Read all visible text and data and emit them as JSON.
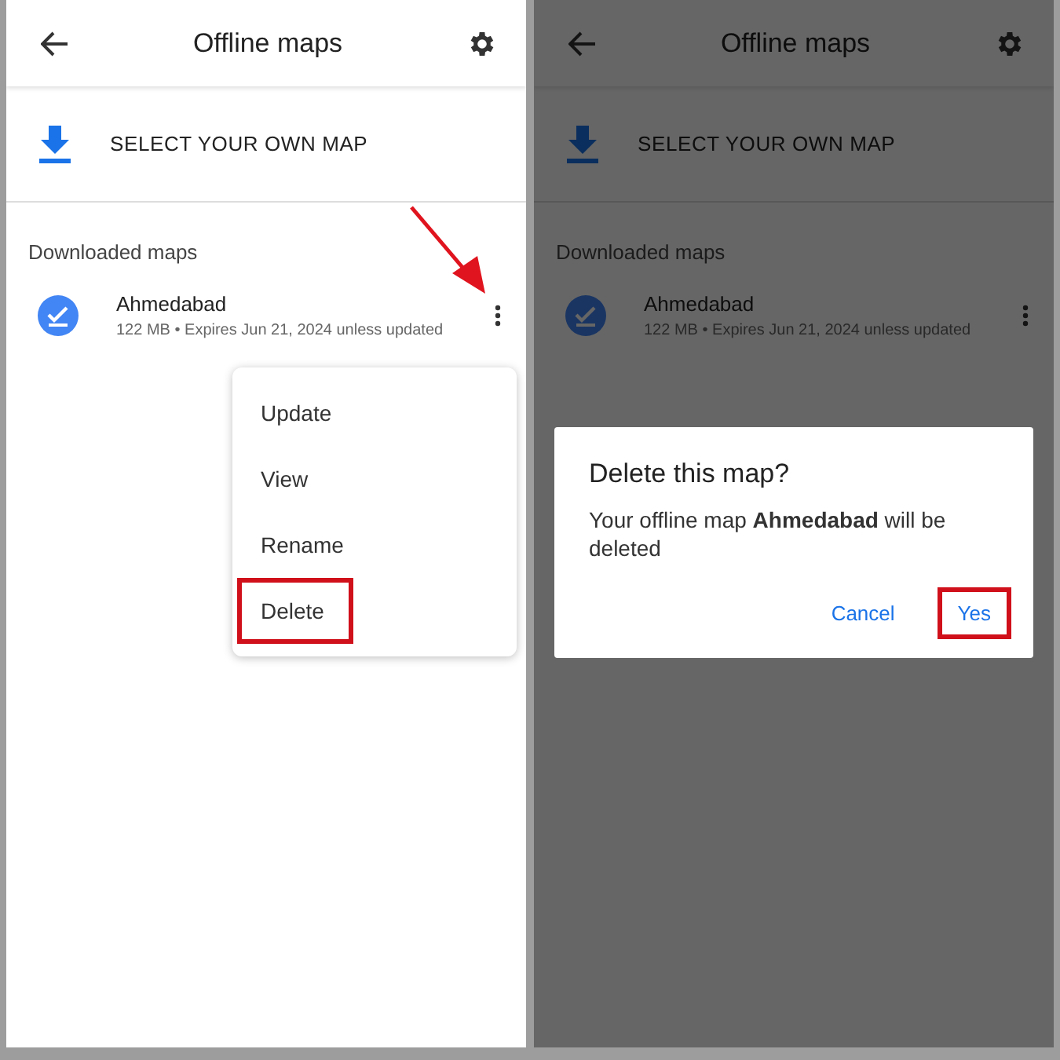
{
  "panels": [
    {
      "dimmed": false,
      "annotation_arrow": true,
      "header": {
        "title": "Offline maps"
      },
      "select_own_map": "SELECT YOUR OWN MAP",
      "section_title": "Downloaded maps",
      "maps": [
        {
          "name": "Ahmedabad",
          "details": "122 MB • Expires Jun 21, 2024 unless updated"
        }
      ],
      "menu": {
        "items": [
          {
            "label": "Update",
            "highlighted": false
          },
          {
            "label": "View",
            "highlighted": false
          },
          {
            "label": "Rename",
            "highlighted": false
          },
          {
            "label": "Delete",
            "highlighted": true
          }
        ]
      }
    },
    {
      "dimmed": true,
      "annotation_arrow": false,
      "header": {
        "title": "Offline maps"
      },
      "select_own_map": "SELECT YOUR OWN MAP",
      "section_title": "Downloaded maps",
      "maps": [
        {
          "name": "Ahmedabad",
          "details": "122 MB • Expires Jun 21, 2024 unless updated"
        }
      ],
      "dialog": {
        "title": "Delete this map?",
        "message": "Your offline map **Ahmedabad** will be deleted",
        "buttons": [
          {
            "label": "Cancel",
            "highlighted": false
          },
          {
            "label": "Yes",
            "highlighted": true
          }
        ]
      }
    }
  ]
}
